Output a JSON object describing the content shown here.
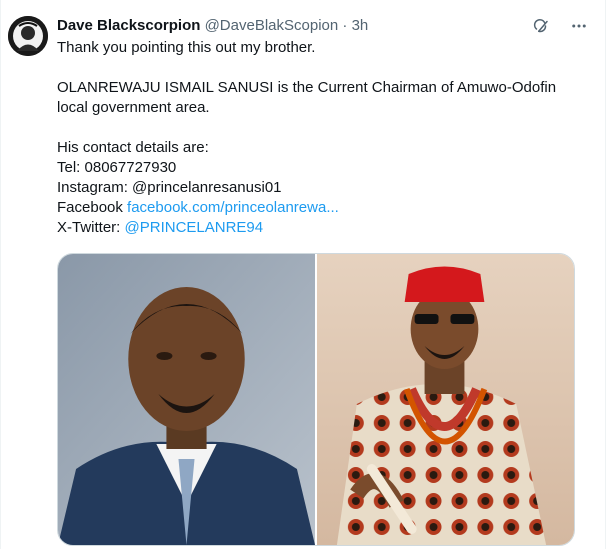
{
  "tweet": {
    "author_name": "Dave Blackscorpion",
    "handle": "@DaveBlakScopion",
    "separator": "·",
    "time": "3h",
    "lines": {
      "l1": "Thank you pointing this out my brother.",
      "l2": "OLANREWAJU ISMAIL SANUSI is the Current Chairman of Amuwo-Odofin",
      "l3": "local government area.",
      "l4": "His contact details are:",
      "l5": "Tel: 08067727930",
      "l6": "Instagram: @princelanresanusi01",
      "l7_label": "Facebook ",
      "l7_link": "facebook.com/princeolanrewa...",
      "l8_label": "X-Twitter: ",
      "l8_link": "@PRINCELANRE94"
    }
  },
  "icons": {
    "grok": "grok-icon",
    "more": "more-icon"
  },
  "colors": {
    "link": "#1d9bf0",
    "secondary_text": "#536471",
    "border": "#cfd9de"
  }
}
